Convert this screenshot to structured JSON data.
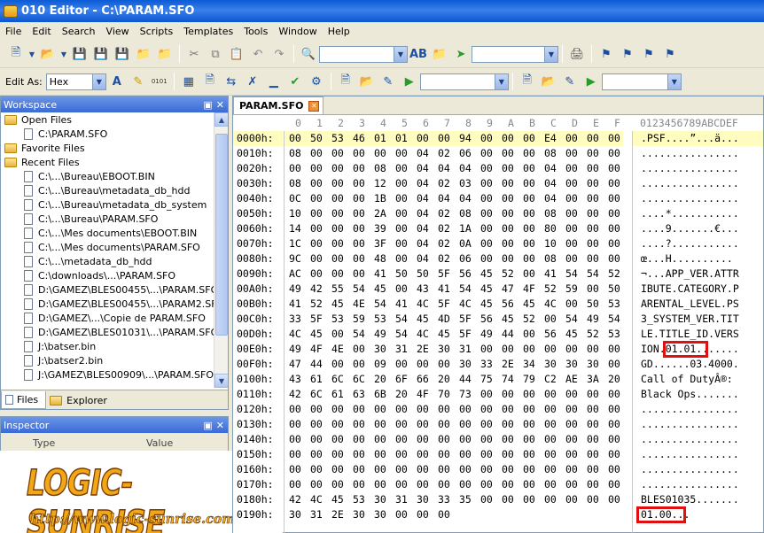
{
  "window": {
    "title": "010 Editor - C:\\PARAM.SFO"
  },
  "menu": [
    "File",
    "Edit",
    "Search",
    "View",
    "Scripts",
    "Templates",
    "Tools",
    "Window",
    "Help"
  ],
  "toolbar2": {
    "edit_as_label": "Edit As:",
    "edit_as_value": "Hex",
    "digits_label": "0101"
  },
  "workspace": {
    "title": "Workspace",
    "items": [
      {
        "label": "Open Files",
        "kind": "folder",
        "indent": 0
      },
      {
        "label": "C:\\PARAM.SFO",
        "kind": "file",
        "indent": 1
      },
      {
        "label": "Favorite Files",
        "kind": "folder",
        "indent": 0
      },
      {
        "label": "Recent Files",
        "kind": "folder",
        "indent": 0
      },
      {
        "label": "C:\\...\\Bureau\\EBOOT.BIN",
        "kind": "file",
        "indent": 1
      },
      {
        "label": "C:\\...\\Bureau\\metadata_db_hdd",
        "kind": "file",
        "indent": 1
      },
      {
        "label": "C:\\...\\Bureau\\metadata_db_system",
        "kind": "file",
        "indent": 1
      },
      {
        "label": "C:\\...\\Bureau\\PARAM.SFO",
        "kind": "file",
        "indent": 1
      },
      {
        "label": "C:\\...\\Mes documents\\EBOOT.BIN",
        "kind": "file",
        "indent": 1
      },
      {
        "label": "C:\\...\\Mes documents\\PARAM.SFO",
        "kind": "file",
        "indent": 1
      },
      {
        "label": "C:\\...\\metadata_db_hdd",
        "kind": "file",
        "indent": 1
      },
      {
        "label": "C:\\downloads\\...\\PARAM.SFO",
        "kind": "file",
        "indent": 1
      },
      {
        "label": "D:\\GAMEZ\\BLES00455\\...\\PARAM.SFO",
        "kind": "file",
        "indent": 1
      },
      {
        "label": "D:\\GAMEZ\\BLES00455\\...\\PARAM2.SFO",
        "kind": "file",
        "indent": 1
      },
      {
        "label": "D:\\GAMEZ\\...\\Copie de PARAM.SFO",
        "kind": "file",
        "indent": 1
      },
      {
        "label": "D:\\GAMEZ\\BLES01031\\...\\PARAM.SFO",
        "kind": "file",
        "indent": 1
      },
      {
        "label": "J:\\batser.bin",
        "kind": "file",
        "indent": 1
      },
      {
        "label": "J:\\batser2.bin",
        "kind": "file",
        "indent": 1
      },
      {
        "label": "J:\\GAMEZ\\BLES00909\\...\\PARAM.SFO",
        "kind": "file",
        "indent": 1
      }
    ],
    "tabs": [
      {
        "label": "Files"
      },
      {
        "label": "Explorer"
      }
    ]
  },
  "inspector": {
    "title": "Inspector",
    "col_type": "Type",
    "col_value": "Value"
  },
  "logo": {
    "name": "LOGIC-SUNRISE",
    "url": "http://www.logic-sunrise.com"
  },
  "editor": {
    "tab": "PARAM.SFO",
    "col_header": [
      "0",
      "1",
      "2",
      "3",
      "4",
      "5",
      "6",
      "7",
      "8",
      "9",
      "A",
      "B",
      "C",
      "D",
      "E",
      "F"
    ],
    "ascii_header": "0123456789ABCDEF",
    "rows": [
      {
        "addr": "0000h:",
        "bytes": [
          "00",
          "50",
          "53",
          "46",
          "01",
          "01",
          "00",
          "00",
          "94",
          "00",
          "00",
          "00",
          "E4",
          "00",
          "00",
          "00"
        ],
        "ascii": ".PSF....”...ä..."
      },
      {
        "addr": "0010h:",
        "bytes": [
          "08",
          "00",
          "00",
          "00",
          "00",
          "00",
          "04",
          "02",
          "06",
          "00",
          "00",
          "00",
          "08",
          "00",
          "00",
          "00"
        ],
        "ascii": "................"
      },
      {
        "addr": "0020h:",
        "bytes": [
          "00",
          "00",
          "00",
          "00",
          "08",
          "00",
          "04",
          "04",
          "04",
          "00",
          "00",
          "00",
          "04",
          "00",
          "00",
          "00"
        ],
        "ascii": "................"
      },
      {
        "addr": "0030h:",
        "bytes": [
          "08",
          "00",
          "00",
          "00",
          "12",
          "00",
          "04",
          "02",
          "03",
          "00",
          "00",
          "00",
          "04",
          "00",
          "00",
          "00"
        ],
        "ascii": "................"
      },
      {
        "addr": "0040h:",
        "bytes": [
          "0C",
          "00",
          "00",
          "00",
          "1B",
          "00",
          "04",
          "04",
          "04",
          "00",
          "00",
          "00",
          "04",
          "00",
          "00",
          "00"
        ],
        "ascii": "................"
      },
      {
        "addr": "0050h:",
        "bytes": [
          "10",
          "00",
          "00",
          "00",
          "2A",
          "00",
          "04",
          "02",
          "08",
          "00",
          "00",
          "00",
          "08",
          "00",
          "00",
          "00"
        ],
        "ascii": "....*..........."
      },
      {
        "addr": "0060h:",
        "bytes": [
          "14",
          "00",
          "00",
          "00",
          "39",
          "00",
          "04",
          "02",
          "1A",
          "00",
          "00",
          "00",
          "80",
          "00",
          "00",
          "00"
        ],
        "ascii": "....9.......€..."
      },
      {
        "addr": "0070h:",
        "bytes": [
          "1C",
          "00",
          "00",
          "00",
          "3F",
          "00",
          "04",
          "02",
          "0A",
          "00",
          "00",
          "00",
          "10",
          "00",
          "00",
          "00"
        ],
        "ascii": "....?..........."
      },
      {
        "addr": "0080h:",
        "bytes": [
          "9C",
          "00",
          "00",
          "00",
          "48",
          "00",
          "04",
          "02",
          "06",
          "00",
          "00",
          "00",
          "08",
          "00",
          "00",
          "00"
        ],
        "ascii": "œ...H.........."
      },
      {
        "addr": "0090h:",
        "bytes": [
          "AC",
          "00",
          "00",
          "00",
          "41",
          "50",
          "50",
          "5F",
          "56",
          "45",
          "52",
          "00",
          "41",
          "54",
          "54",
          "52"
        ],
        "ascii": "¬...APP_VER.ATTR"
      },
      {
        "addr": "00A0h:",
        "bytes": [
          "49",
          "42",
          "55",
          "54",
          "45",
          "00",
          "43",
          "41",
          "54",
          "45",
          "47",
          "4F",
          "52",
          "59",
          "00",
          "50"
        ],
        "ascii": "IBUTE.CATEGORY.P"
      },
      {
        "addr": "00B0h:",
        "bytes": [
          "41",
          "52",
          "45",
          "4E",
          "54",
          "41",
          "4C",
          "5F",
          "4C",
          "45",
          "56",
          "45",
          "4C",
          "00",
          "50",
          "53"
        ],
        "ascii": "ARENTAL_LEVEL.PS"
      },
      {
        "addr": "00C0h:",
        "bytes": [
          "33",
          "5F",
          "53",
          "59",
          "53",
          "54",
          "45",
          "4D",
          "5F",
          "56",
          "45",
          "52",
          "00",
          "54",
          "49",
          "54"
        ],
        "ascii": "3_SYSTEM_VER.TIT"
      },
      {
        "addr": "00D0h:",
        "bytes": [
          "4C",
          "45",
          "00",
          "54",
          "49",
          "54",
          "4C",
          "45",
          "5F",
          "49",
          "44",
          "00",
          "56",
          "45",
          "52",
          "53"
        ],
        "ascii": "LE.TITLE_ID.VERS"
      },
      {
        "addr": "00E0h:",
        "bytes": [
          "49",
          "4F",
          "4E",
          "00",
          "30",
          "31",
          "2E",
          "30",
          "31",
          "00",
          "00",
          "00",
          "00",
          "00",
          "00",
          "00"
        ],
        "ascii": "ION.01.01......."
      },
      {
        "addr": "00F0h:",
        "bytes": [
          "47",
          "44",
          "00",
          "00",
          "09",
          "00",
          "00",
          "00",
          "30",
          "33",
          "2E",
          "34",
          "30",
          "30",
          "30",
          "00"
        ],
        "ascii": "GD......03.4000."
      },
      {
        "addr": "0100h:",
        "bytes": [
          "43",
          "61",
          "6C",
          "6C",
          "20",
          "6F",
          "66",
          "20",
          "44",
          "75",
          "74",
          "79",
          "C2",
          "AE",
          "3A",
          "20"
        ],
        "ascii": "Call of DutyÂ®: "
      },
      {
        "addr": "0110h:",
        "bytes": [
          "42",
          "6C",
          "61",
          "63",
          "6B",
          "20",
          "4F",
          "70",
          "73",
          "00",
          "00",
          "00",
          "00",
          "00",
          "00",
          "00"
        ],
        "ascii": "Black Ops......."
      },
      {
        "addr": "0120h:",
        "bytes": [
          "00",
          "00",
          "00",
          "00",
          "00",
          "00",
          "00",
          "00",
          "00",
          "00",
          "00",
          "00",
          "00",
          "00",
          "00",
          "00"
        ],
        "ascii": "................"
      },
      {
        "addr": "0130h:",
        "bytes": [
          "00",
          "00",
          "00",
          "00",
          "00",
          "00",
          "00",
          "00",
          "00",
          "00",
          "00",
          "00",
          "00",
          "00",
          "00",
          "00"
        ],
        "ascii": "................"
      },
      {
        "addr": "0140h:",
        "bytes": [
          "00",
          "00",
          "00",
          "00",
          "00",
          "00",
          "00",
          "00",
          "00",
          "00",
          "00",
          "00",
          "00",
          "00",
          "00",
          "00"
        ],
        "ascii": "................"
      },
      {
        "addr": "0150h:",
        "bytes": [
          "00",
          "00",
          "00",
          "00",
          "00",
          "00",
          "00",
          "00",
          "00",
          "00",
          "00",
          "00",
          "00",
          "00",
          "00",
          "00"
        ],
        "ascii": "................"
      },
      {
        "addr": "0160h:",
        "bytes": [
          "00",
          "00",
          "00",
          "00",
          "00",
          "00",
          "00",
          "00",
          "00",
          "00",
          "00",
          "00",
          "00",
          "00",
          "00",
          "00"
        ],
        "ascii": "................"
      },
      {
        "addr": "0170h:",
        "bytes": [
          "00",
          "00",
          "00",
          "00",
          "00",
          "00",
          "00",
          "00",
          "00",
          "00",
          "00",
          "00",
          "00",
          "00",
          "00",
          "00"
        ],
        "ascii": "................"
      },
      {
        "addr": "0180h:",
        "bytes": [
          "42",
          "4C",
          "45",
          "53",
          "30",
          "31",
          "30",
          "33",
          "35",
          "00",
          "00",
          "00",
          "00",
          "00",
          "00",
          "00"
        ],
        "ascii": "BLES01035......."
      },
      {
        "addr": "0190h:",
        "bytes": [
          "30",
          "31",
          "2E",
          "30",
          "30",
          "00",
          "00",
          "00",
          "",
          "",
          "",
          "",
          "",
          "",
          "",
          ""
        ],
        "ascii": "01.00..."
      }
    ]
  }
}
